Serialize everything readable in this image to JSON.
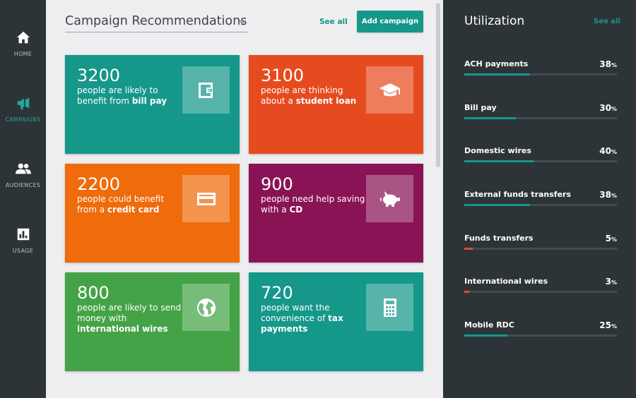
{
  "nav": [
    {
      "label": "HOME",
      "icon": "home-icon",
      "active": false
    },
    {
      "label": "CAMPAIGNS",
      "icon": "megaphone-icon",
      "active": true
    },
    {
      "label": "AUDIENCES",
      "icon": "people-icon",
      "active": false
    },
    {
      "label": "USAGE",
      "icon": "bar-chart-icon",
      "active": false
    }
  ],
  "header": {
    "selected": "Campaign Recommendations",
    "see_all": "See all",
    "add_campaign": "Add campaign"
  },
  "cards": [
    {
      "count": "3200",
      "pre": "people are likely to benefit from ",
      "bold": "bill pay",
      "post": "",
      "color": "#15978a",
      "icon": "wallet-icon"
    },
    {
      "count": "3100",
      "pre": "people are thinking about a ",
      "bold": "student loan",
      "post": "",
      "color": "#e64b1f",
      "icon": "graduation-cap-icon"
    },
    {
      "count": "2200",
      "pre": "people could benefit from a ",
      "bold": "credit card",
      "post": "",
      "color": "#ef6b0b",
      "icon": "credit-card-icon"
    },
    {
      "count": "900",
      "pre": "people need help saving with a ",
      "bold": "CD",
      "post": "",
      "color": "#8a1356",
      "icon": "piggy-bank-icon"
    },
    {
      "count": "800",
      "pre": "people are likely to send money with ",
      "bold": "international wires",
      "post": "",
      "color": "#45a347",
      "icon": "globe-icon"
    },
    {
      "count": "720",
      "pre": "people want the convenience of ",
      "bold": "tax payments",
      "post": "",
      "color": "#15978a",
      "icon": "calculator-icon"
    }
  ],
  "utilization": {
    "title": "Utilization",
    "see_all": "See all",
    "pct_sign": "%",
    "items": [
      {
        "name": "ACH payments",
        "value": 38,
        "color": "#15978a"
      },
      {
        "name": "Bill pay",
        "value": 30,
        "color": "#15978a"
      },
      {
        "name": "Domestic wires",
        "value": 40,
        "color": "#15978a"
      },
      {
        "name": "External funds transfers",
        "value": 38,
        "color": "#15978a"
      },
      {
        "name": "Funds transfers",
        "value": 5,
        "color": "#e64b1f"
      },
      {
        "name": "International wires",
        "value": 3,
        "color": "#e64b1f"
      },
      {
        "name": "Mobile RDC",
        "value": 25,
        "color": "#15978a"
      }
    ]
  }
}
